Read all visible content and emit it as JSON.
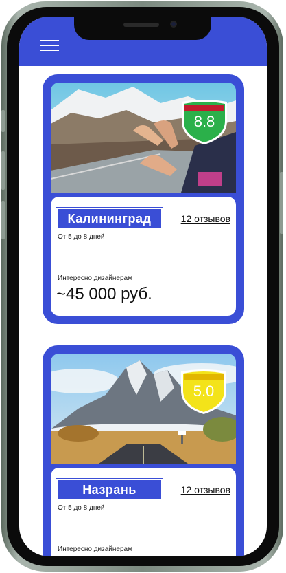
{
  "header": {
    "menu_icon": "hamburger-menu-icon",
    "color": "#3a4ed6"
  },
  "tours": [
    {
      "city": "Калининград",
      "reviews": "12 отзывов",
      "duration": "От 5 до 8 дней",
      "audience": "Интересно дизайнерам",
      "price": "~45 000 руб.",
      "rating": "8.8",
      "rating_color": "#2bb04a",
      "photo": "hands-out-car-window-mountain-road"
    },
    {
      "city": "Назрань",
      "reviews": "12 отзывов",
      "duration": "От 5 до 8 дней",
      "audience": "Интересно дизайнерам",
      "rating": "5.0",
      "rating_color": "#f3e31a",
      "photo": "mountain-highway-landscape"
    }
  ]
}
